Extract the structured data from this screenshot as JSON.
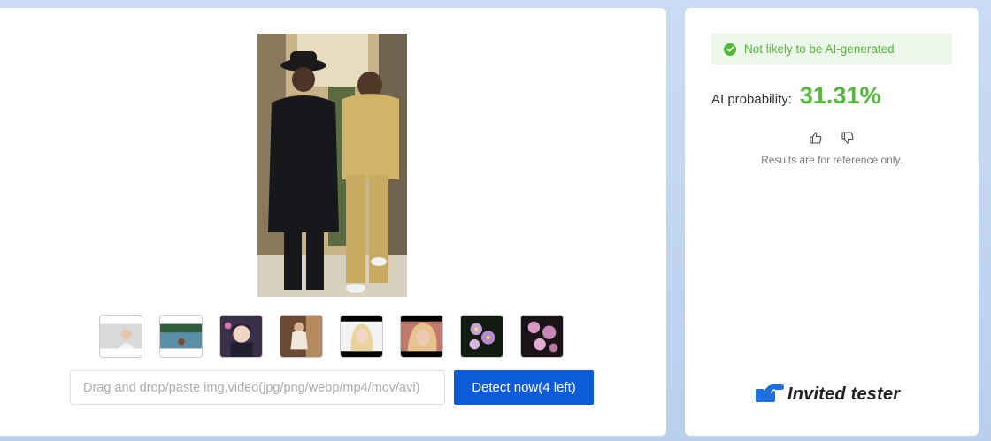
{
  "upload": {
    "placeholder": "Drag and drop/paste img,video(jpg/png/webp/mp4/mov/avi)",
    "detect_label": "Detect now(4 left)"
  },
  "preview": {
    "icon": "uploaded-photo"
  },
  "samples": [
    {
      "icon": "sample-woman-portrait"
    },
    {
      "icon": "sample-lake-landscape"
    },
    {
      "icon": "sample-anime-girl"
    },
    {
      "icon": "sample-woman-sitting"
    },
    {
      "icon": "sample-blonde-woman"
    },
    {
      "icon": "sample-woman-closeup"
    },
    {
      "icon": "sample-purple-flowers"
    },
    {
      "icon": "sample-pink-flowers"
    }
  ],
  "result": {
    "verdict": "Not likely to be AI-generated",
    "probability_label": "AI probability:",
    "probability_value": "31.31%",
    "disclaimer": "Results are for reference only."
  },
  "badge": {
    "label": "Invited tester"
  },
  "colors": {
    "accent_blue": "#0d5bd6",
    "success_green": "#52b83a",
    "verdict_bg": "#eef8ea"
  }
}
